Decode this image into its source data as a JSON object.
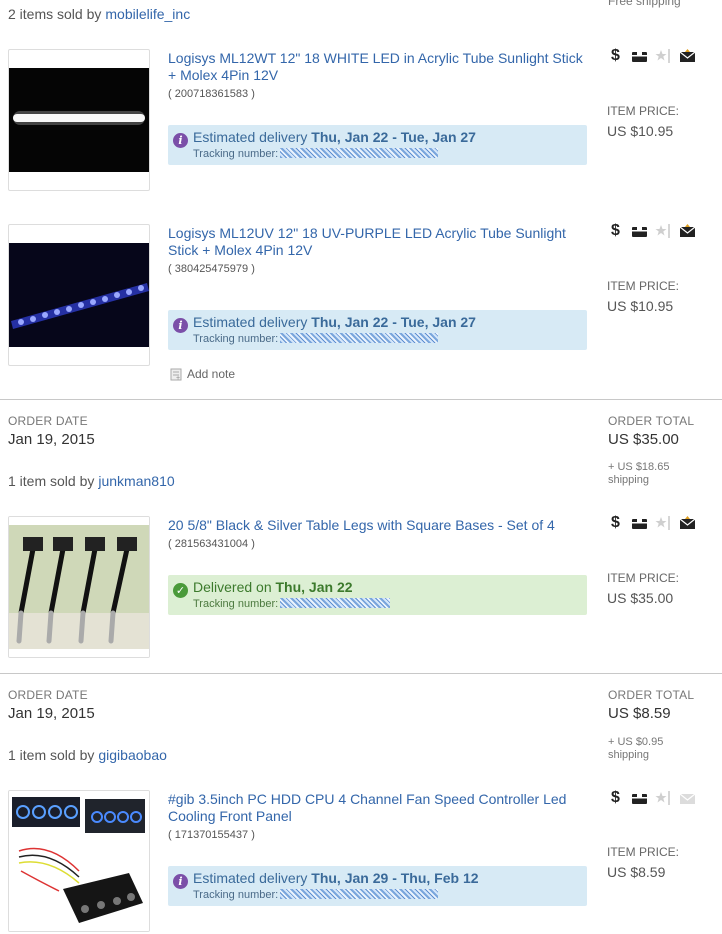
{
  "group1": {
    "sold_by_prefix": "2 items sold by",
    "seller": "mobilelife_inc",
    "top_right": "Free shipping"
  },
  "items": [
    {
      "title": "Logisys ML12WT 12\" 18 WHITE LED in Acrylic Tube Sunlight Stick + Molex 4Pin 12V",
      "item_id": "( 200718361583 )",
      "delivery_prefix": "Estimated delivery",
      "delivery_dates": "Thu, Jan 22 - Tue, Jan 27",
      "tracking_label": "Tracking number:",
      "price_label": "ITEM PRICE:",
      "price": "US $10.95"
    },
    {
      "title": "Logisys ML12UV 12\" 18 UV-PURPLE LED Acrylic Tube Sunlight Stick + Molex 4Pin 12V",
      "item_id": "( 380425475979 )",
      "delivery_prefix": "Estimated delivery",
      "delivery_dates": "Thu, Jan 22 - Tue, Jan 27",
      "tracking_label": "Tracking number:",
      "price_label": "ITEM PRICE:",
      "price": "US $10.95",
      "add_note": "Add note"
    },
    {
      "title": "20 5/8\" Black & Silver Table Legs with Square Bases - Set of 4",
      "item_id": "( 281563431004 )",
      "delivery_prefix": "Delivered on",
      "delivery_dates": "Thu, Jan 22",
      "tracking_label": "Tracking number:",
      "price_label": "ITEM PRICE:",
      "price": "US $35.00"
    },
    {
      "title": "#gib 3.5inch PC HDD CPU 4 Channel Fan Speed Controller Led Cooling Front Panel",
      "item_id": "( 171370155437 )",
      "delivery_prefix": "Estimated delivery",
      "delivery_dates": "Thu, Jan 29 - Thu, Feb 12",
      "tracking_label": "Tracking number:",
      "price_label": "ITEM PRICE:",
      "price": "US $8.59"
    }
  ],
  "orders": [
    {
      "date_label": "ORDER DATE",
      "date": "Jan 19, 2015",
      "total_label": "ORDER TOTAL",
      "total": "US $35.00",
      "shipping_line1": "+ US $18.65",
      "shipping_line2": "shipping",
      "sold_by_prefix": "1 item sold by",
      "seller": "junkman810"
    },
    {
      "date_label": "ORDER DATE",
      "date": "Jan 19, 2015",
      "total_label": "ORDER TOTAL",
      "total": "US $8.59",
      "shipping_line1": "+ US $0.95",
      "shipping_line2": "shipping",
      "sold_by_prefix": "1 item sold by",
      "seller": "gigibaobao"
    }
  ],
  "action_icons": [
    "dollar-icon",
    "shipped-box-icon",
    "feedback-star-icon",
    "message-envelope-icon"
  ],
  "colors": {
    "link": "#3366aa",
    "estimated_bg": "#d7eaf5",
    "delivered_bg": "#dcefd3",
    "info_icon": "#7b4fa8",
    "delivered_icon": "#4a9a3a"
  }
}
